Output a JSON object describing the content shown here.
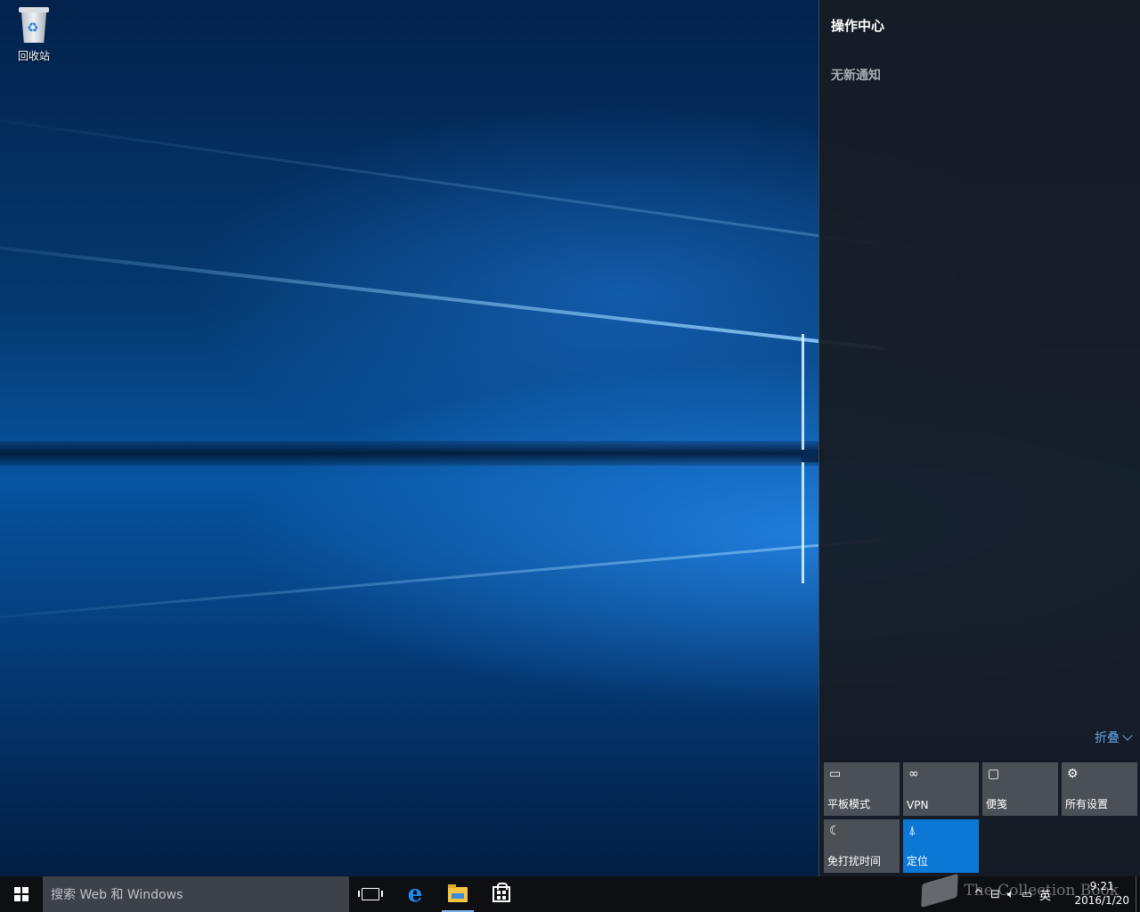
{
  "desktop": {
    "icons": [
      {
        "label": "回收站",
        "icon": "recycle-bin-icon"
      }
    ]
  },
  "action_center": {
    "title": "操作中心",
    "empty_message": "无新通知",
    "collapse_label": "折叠",
    "tiles": [
      {
        "label": "平板模式",
        "icon": "tablet-mode-icon",
        "active": false
      },
      {
        "label": "VPN",
        "icon": "vpn-icon",
        "active": false
      },
      {
        "label": "便笺",
        "icon": "note-icon",
        "active": false
      },
      {
        "label": "所有设置",
        "icon": "gear-icon",
        "active": false
      },
      {
        "label": "免打扰时间",
        "icon": "moon-icon",
        "active": false
      },
      {
        "label": "定位",
        "icon": "location-icon",
        "active": true
      }
    ],
    "accent_color": "#0c78d6"
  },
  "taskbar": {
    "search_placeholder": "搜索 Web 和 Windows",
    "pinned": [
      {
        "name": "task-view",
        "icon": "task-view-icon"
      },
      {
        "name": "edge",
        "icon": "edge-icon"
      },
      {
        "name": "file-explorer",
        "icon": "folder-icon"
      },
      {
        "name": "store",
        "icon": "store-icon"
      }
    ],
    "tray": {
      "ime": "英",
      "time": "9:21",
      "date": "2016/1/20"
    },
    "watermark": "The Collection Book"
  }
}
